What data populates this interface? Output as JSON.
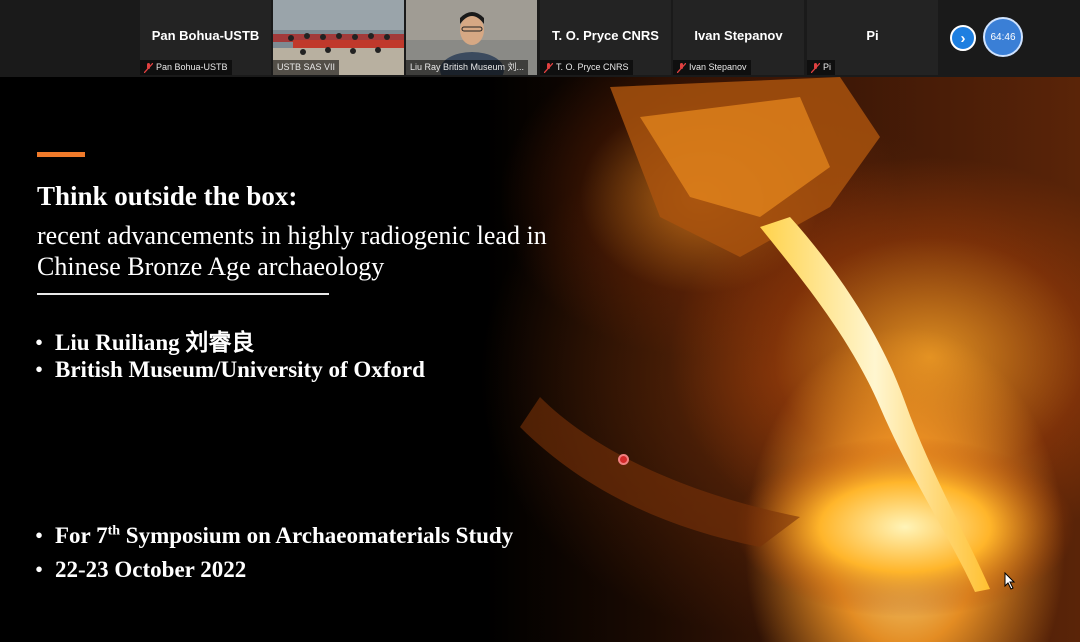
{
  "participants": [
    {
      "big_name": "Pan Bohua-USTB",
      "tag": "Pan Bohua-USTB",
      "muted": true
    },
    {
      "big_name": "",
      "tag": "USTB SAS VII",
      "muted": false
    },
    {
      "big_name": "",
      "tag": "Liu Ray British Museum 刘...",
      "muted": false
    },
    {
      "big_name": "T. O. Pryce CNRS",
      "tag": "T. O. Pryce CNRS",
      "muted": true
    },
    {
      "big_name": "Ivan Stepanov",
      "tag": "Ivan Stepanov",
      "muted": true
    },
    {
      "big_name": "Pi",
      "tag": "Pi",
      "muted": true
    }
  ],
  "controls": {
    "next_icon": "chevron-right-icon",
    "timer": "64:46"
  },
  "slide": {
    "title": "Think outside the box:",
    "subtitle": "recent advancements in highly radiogenic lead in Chinese Bronze Age archaeology",
    "author": "Liu Ruiliang 刘睿良",
    "affiliation": "British Museum/University of Oxford",
    "event_prefix": "For 7",
    "event_sup": "th",
    "event_suffix": " Symposium on Archaeomaterials Study",
    "dates": "22-23 October 2022",
    "bullet": "•"
  },
  "colors": {
    "accent": "#f07a2a",
    "nav": "#1e7fe0",
    "mic_off": "#e04040"
  }
}
